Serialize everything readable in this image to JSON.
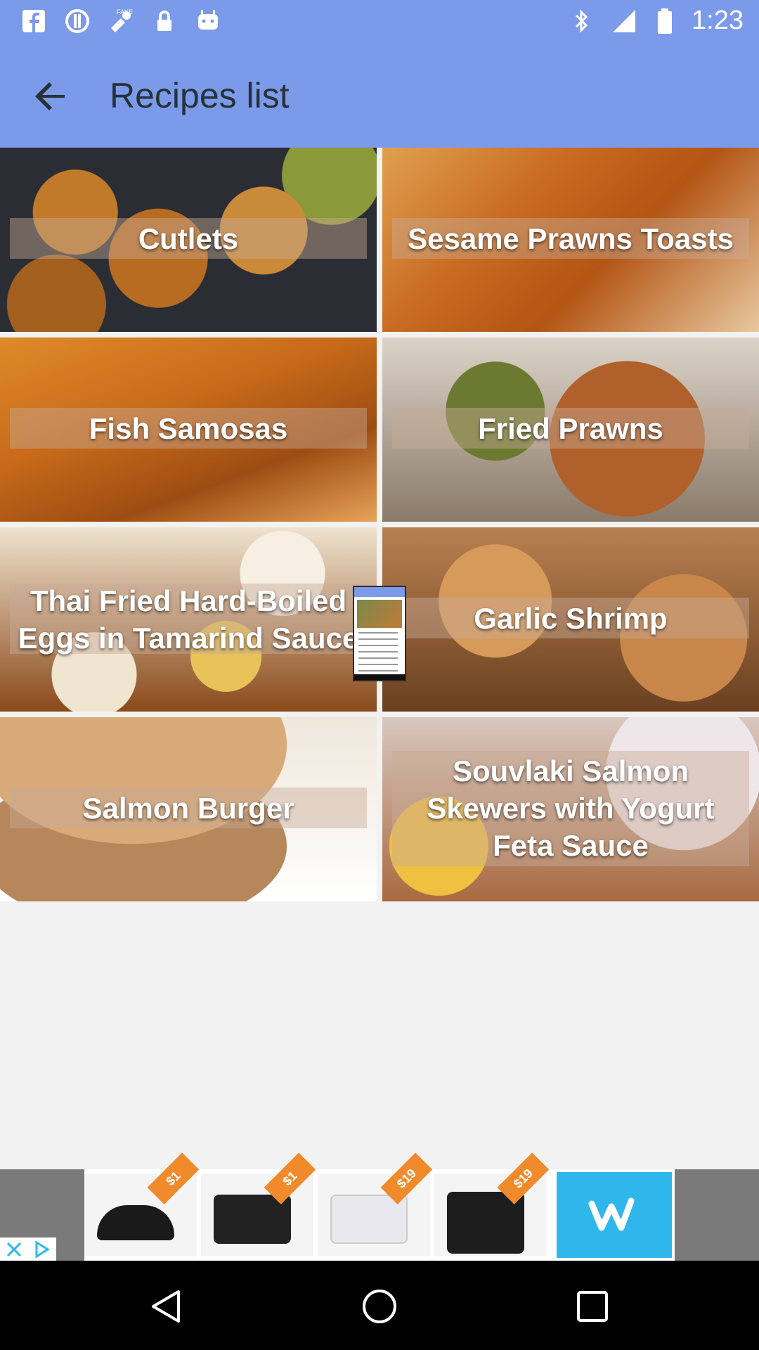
{
  "status_bar": {
    "time": "1:23",
    "left_icons": [
      "facebook-icon",
      "circle-info-icon",
      "fake-gps-icon",
      "lock-icon",
      "android-icon"
    ],
    "right_icons": [
      "bluetooth-icon",
      "signal-icon",
      "battery-icon"
    ]
  },
  "app_bar": {
    "title": "Recipes list",
    "back_icon": "arrow-left-icon"
  },
  "recipes": [
    {
      "label": "Cutlets"
    },
    {
      "label": "Sesame Prawns Toasts"
    },
    {
      "label": "Fish Samosas"
    },
    {
      "label": "Fried Prawns"
    },
    {
      "label": "Thai Fried Hard-Boiled Eggs in Tamarind Sauce"
    },
    {
      "label": "Garlic Shrimp"
    },
    {
      "label": "Salmon Burger"
    },
    {
      "label": "Souvlaki Salmon Skewers with Yogurt Feta Sauce"
    }
  ],
  "ad_banner": {
    "price_tags": [
      "$1",
      "$1",
      "$19",
      "$19"
    ],
    "brand_icon": "wish-logo-icon",
    "close_icon": "close-icon",
    "adchoices_icon": "adchoices-icon"
  },
  "nav_bar": {
    "buttons": [
      "back-triangle-icon",
      "home-circle-icon",
      "recents-square-icon"
    ]
  },
  "colors": {
    "primary": "#7b9bea",
    "title_text": "#263238",
    "background": "#f2f2f2"
  }
}
